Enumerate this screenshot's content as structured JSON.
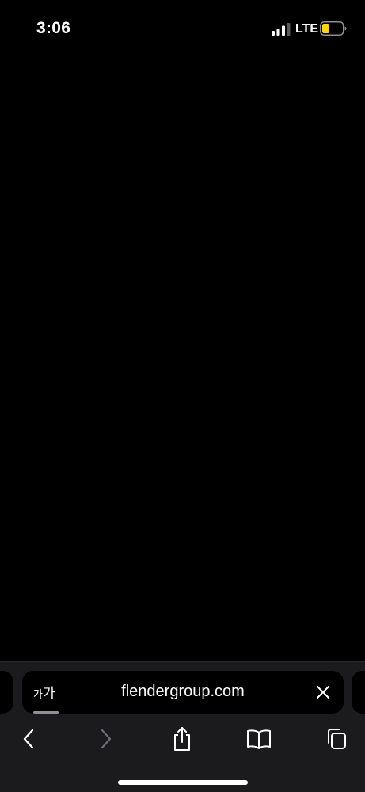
{
  "status_bar": {
    "time": "3:06",
    "network": "LTE",
    "signal_bars": 3,
    "battery_color": "#ffd60a"
  },
  "address_bar": {
    "text_size_label_small": "가",
    "text_size_label_large": "가",
    "url": "flendergroup.com"
  },
  "toolbar": {
    "icons": [
      "back-icon",
      "forward-icon",
      "share-icon",
      "bookmarks-icon",
      "tabs-icon"
    ],
    "forward_enabled": false
  },
  "colors": {
    "toolbar_bg": "#1b1b1d",
    "page_bg": "#000000",
    "icon_active": "#ffffff",
    "icon_disabled": "#6e6e73"
  }
}
